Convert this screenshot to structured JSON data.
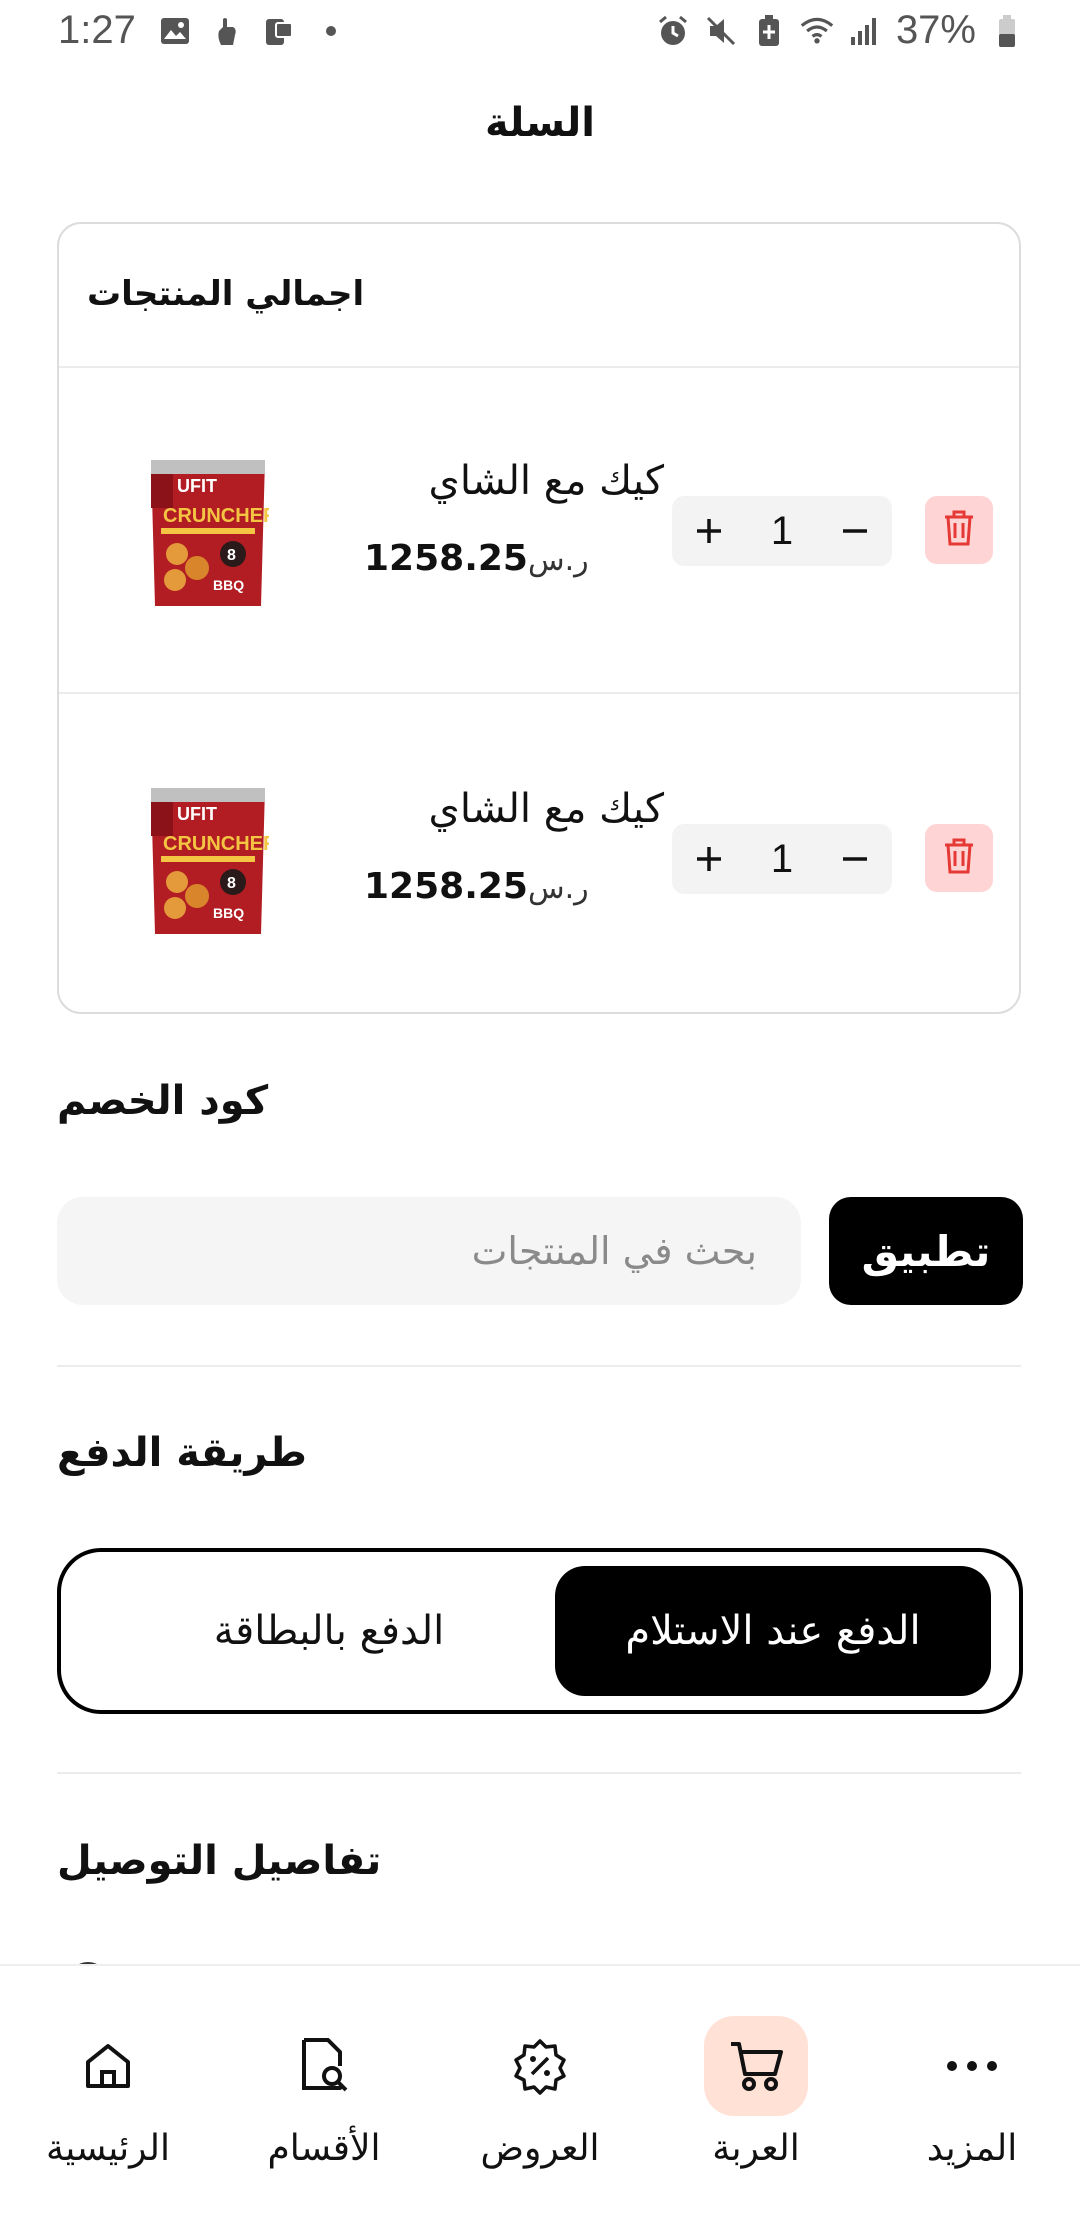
{
  "status_bar": {
    "time": "1:27",
    "battery": "37%"
  },
  "header": {
    "title": "السلة"
  },
  "cart": {
    "header_label": "اجمالي المنتجات",
    "items": [
      {
        "name": "كيك مع الشاي",
        "price": "1258.25",
        "currency": "ر.س",
        "quantity": "1",
        "image": "ufit-crunchers-bbq"
      },
      {
        "name": "كيك مع الشاي",
        "price": "1258.25",
        "currency": "ر.س",
        "quantity": "1",
        "image": "ufit-crunchers-bbq"
      }
    ]
  },
  "coupon": {
    "title": "كود الخصم",
    "placeholder": "بحث في المنتجات",
    "apply_label": "تطبيق"
  },
  "payment": {
    "title": "طريقة الدفع",
    "options": [
      "الدفع عند الاستلام",
      "الدفع بالبطاقة"
    ],
    "selected": "الدفع عند الاستلام"
  },
  "delivery": {
    "title": "تفاصيل التوصيل"
  },
  "bottom_nav": {
    "items": [
      {
        "label": "الرئيسية",
        "icon": "home-icon"
      },
      {
        "label": "الأقسام",
        "icon": "categories-icon"
      },
      {
        "label": "العروض",
        "icon": "offers-icon"
      },
      {
        "label": "العربة",
        "icon": "cart-icon",
        "active": true
      },
      {
        "label": "المزيد",
        "icon": "more-icon"
      }
    ]
  },
  "colors": {
    "accent_active_bg": "#ffe1d6",
    "delete_bg": "#ffd4d4",
    "delete_icon": "#e53935",
    "primary": "#000000"
  }
}
